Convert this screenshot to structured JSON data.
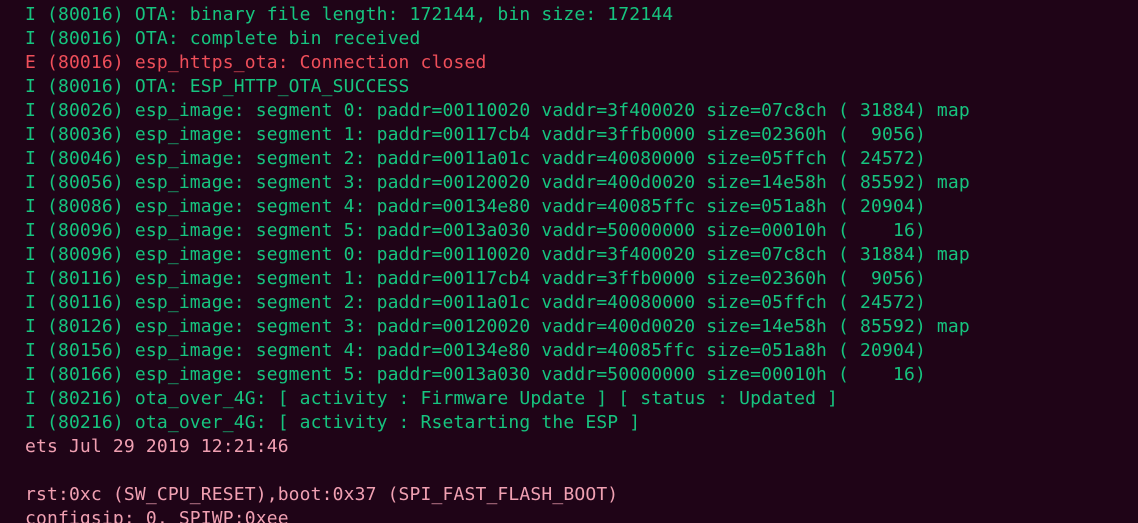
{
  "terminal": {
    "colors": {
      "background": "#1f0417",
      "info": "#16c47f",
      "error": "#ef4f5a",
      "boot": "#f0a0b2"
    },
    "lines": [
      "I (80016) OTA: binary file length: 172144, bin size: 172144",
      "I (80016) OTA: complete bin received",
      "E (80016) esp_https_ota: Connection closed",
      "I (80016) OTA: ESP_HTTP_OTA_SUCCESS",
      "I (80026) esp_image: segment 0: paddr=00110020 vaddr=3f400020 size=07c8ch ( 31884) map",
      "I (80036) esp_image: segment 1: paddr=00117cb4 vaddr=3ffb0000 size=02360h (  9056)",
      "I (80046) esp_image: segment 2: paddr=0011a01c vaddr=40080000 size=05ffch ( 24572)",
      "I (80056) esp_image: segment 3: paddr=00120020 vaddr=400d0020 size=14e58h ( 85592) map",
      "I (80086) esp_image: segment 4: paddr=00134e80 vaddr=40085ffc size=051a8h ( 20904)",
      "I (80096) esp_image: segment 5: paddr=0013a030 vaddr=50000000 size=00010h (    16)",
      "I (80096) esp_image: segment 0: paddr=00110020 vaddr=3f400020 size=07c8ch ( 31884) map",
      "I (80116) esp_image: segment 1: paddr=00117cb4 vaddr=3ffb0000 size=02360h (  9056)",
      "I (80116) esp_image: segment 2: paddr=0011a01c vaddr=40080000 size=05ffch ( 24572)",
      "I (80126) esp_image: segment 3: paddr=00120020 vaddr=400d0020 size=14e58h ( 85592) map",
      "I (80156) esp_image: segment 4: paddr=00134e80 vaddr=40085ffc size=051a8h ( 20904)",
      "I (80166) esp_image: segment 5: paddr=0013a030 vaddr=50000000 size=00010h (    16)",
      "I (80216) ota_over_4G: [ activity : Firmware Update ] [ status : Updated ]",
      "I (80216) ota_over_4G: [ activity : Rsetarting the ESP ]",
      "ets Jul 29 2019 12:21:46",
      "",
      "rst:0xc (SW_CPU_RESET),boot:0x37 (SPI_FAST_FLASH_BOOT)",
      "configsip: 0, SPIWP:0xee"
    ]
  }
}
